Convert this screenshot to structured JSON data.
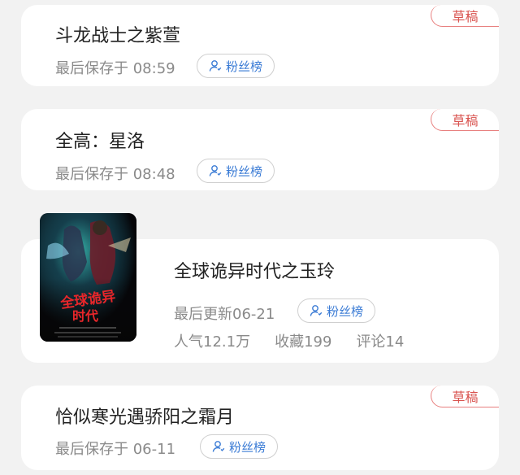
{
  "cards": [
    {
      "type": "draft",
      "badge": "草稿",
      "title": "斗龙战士之紫萱",
      "saved": "最后保存于 08:59",
      "fans_label": "粉丝榜"
    },
    {
      "type": "draft",
      "badge": "草稿",
      "title": "全高：星洛",
      "saved": "最后保存于 08:48",
      "fans_label": "粉丝榜"
    },
    {
      "type": "published",
      "title": "全球诡异时代之玉玲",
      "updated": "最后更新06-21",
      "fans_label": "粉丝榜",
      "stats": [
        "人气12.1万",
        "收藏199",
        "评论14"
      ],
      "cover": {
        "title_line1": "全球诡异",
        "title_line2": "时代"
      }
    },
    {
      "type": "draft",
      "badge": "草稿",
      "title": "恰似寒光遇骄阳之霜月",
      "saved": "最后保存于 06-11",
      "fans_label": "粉丝榜"
    }
  ],
  "colors": {
    "badge": "#d9534f",
    "fans_text": "#3a7bd5",
    "background": "#f2f2f2"
  }
}
